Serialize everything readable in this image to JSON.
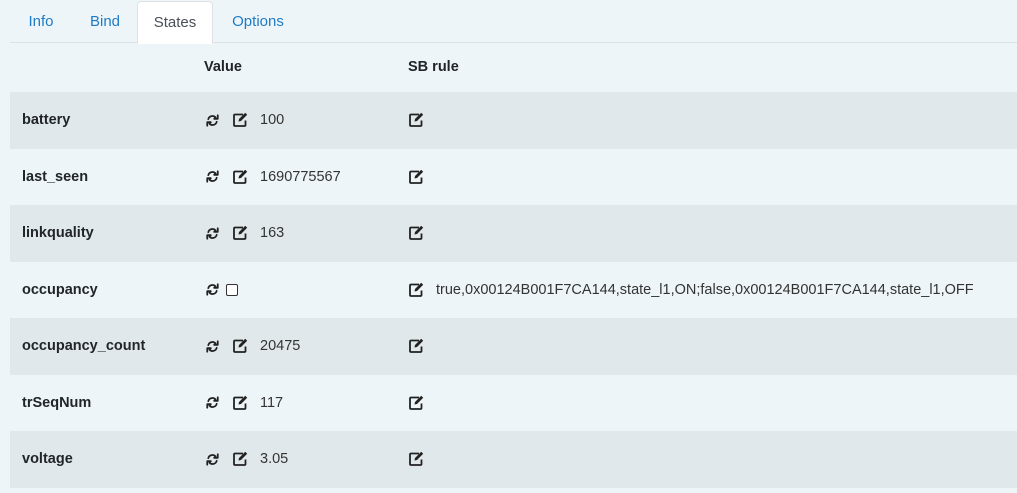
{
  "tabs": [
    {
      "label": "Info",
      "active": false
    },
    {
      "label": "Bind",
      "active": false
    },
    {
      "label": "States",
      "active": true
    },
    {
      "label": "Options",
      "active": false
    }
  ],
  "table": {
    "headers": {
      "name": "",
      "value": "Value",
      "rule": "SB rule"
    },
    "rows": [
      {
        "name": "battery",
        "value": "100",
        "rule": ""
      },
      {
        "name": "last_seen",
        "value": "1690775567",
        "rule": ""
      },
      {
        "name": "linkquality",
        "value": "163",
        "rule": ""
      },
      {
        "name": "occupancy",
        "value": "",
        "checkbox": true,
        "checked": false,
        "rule": "true,0x00124B001F7CA144,state_l1,ON;false,0x00124B001F7CA144,state_l1,OFF"
      },
      {
        "name": "occupancy_count",
        "value": "20475",
        "rule": ""
      },
      {
        "name": "trSeqNum",
        "value": "117",
        "rule": ""
      },
      {
        "name": "voltage",
        "value": "3.05",
        "rule": ""
      }
    ]
  },
  "icons": {
    "refresh": "refresh-icon",
    "edit": "edit-icon"
  },
  "colors": {
    "accent": "#1e7bc7",
    "stripe": "#e1e8eb",
    "background": "#eef5f8"
  }
}
